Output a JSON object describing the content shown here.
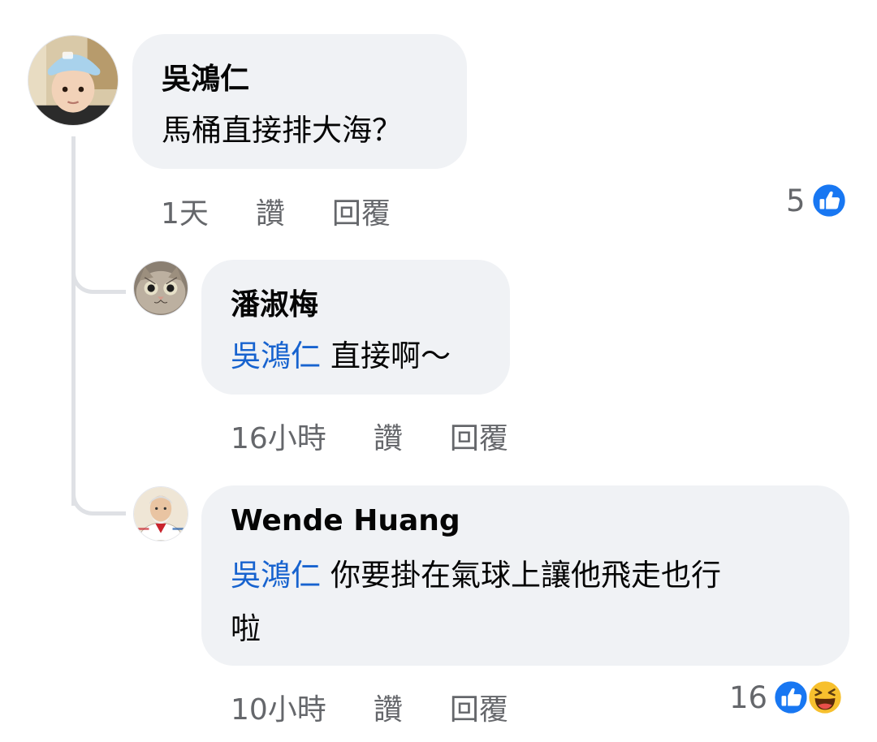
{
  "comments": [
    {
      "author": "吳鴻仁",
      "text": "馬桶直接排大海？",
      "time": "1天",
      "like_label": "讚",
      "reply_label": "回覆",
      "reaction_count": "5",
      "reaction_icons": [
        "like-icon"
      ]
    },
    {
      "author": "潘淑梅",
      "mention": "吳鴻仁",
      "text": "直接啊～",
      "time": "16小時",
      "like_label": "讚",
      "reply_label": "回覆"
    },
    {
      "author": "Wende Huang",
      "mention": "吳鴻仁",
      "text_line1": "你要掛在氣球上讓他飛走也行",
      "text_line2": "啦",
      "time": "10小時",
      "like_label": "讚",
      "reply_label": "回覆",
      "reaction_count": "16",
      "reaction_icons": [
        "like-icon",
        "haha-icon"
      ]
    }
  ],
  "colors": {
    "bubble_bg": "#f0f2f5",
    "mention": "#1763cf",
    "secondary_text": "#65676b",
    "like_blue": "#1877f2",
    "thread_line": "#dfe1e5"
  }
}
